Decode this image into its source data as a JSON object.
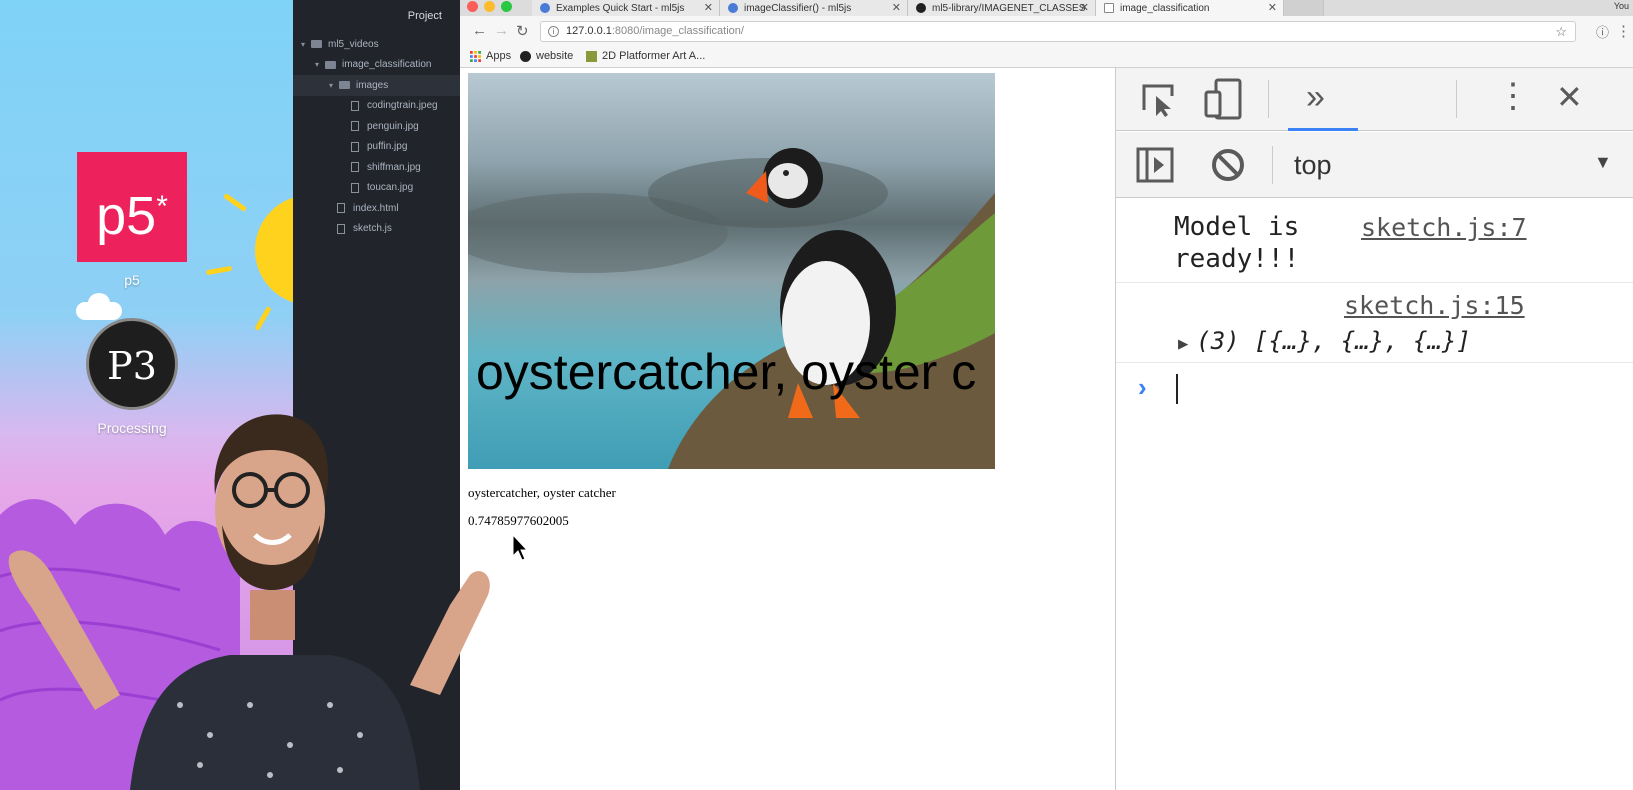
{
  "desktop": {
    "icons": [
      {
        "label": "p5",
        "tile_text": "p5",
        "tile_sup": "*"
      },
      {
        "label": "Processing"
      }
    ]
  },
  "editor": {
    "header": "Project",
    "tree": [
      {
        "label": "ml5_videos",
        "type": "folder",
        "expanded": true,
        "depth": 0
      },
      {
        "label": "image_classification",
        "type": "folder",
        "expanded": true,
        "depth": 1
      },
      {
        "label": "images",
        "type": "folder",
        "expanded": true,
        "depth": 2,
        "selected": true
      },
      {
        "label": "codingtrain.jpeg",
        "type": "file",
        "depth": 3
      },
      {
        "label": "penguin.jpg",
        "type": "file",
        "depth": 3
      },
      {
        "label": "puffin.jpg",
        "type": "file",
        "depth": 3
      },
      {
        "label": "shiffman.jpg",
        "type": "file",
        "depth": 3
      },
      {
        "label": "toucan.jpg",
        "type": "file",
        "depth": 3
      },
      {
        "label": "index.html",
        "type": "file",
        "depth": 2
      },
      {
        "label": "sketch.js",
        "type": "file",
        "depth": 2
      }
    ]
  },
  "browser": {
    "tabs": [
      {
        "title": "Examples Quick Start - ml5js",
        "icon": "ml5-icon"
      },
      {
        "title": "imageClassifier() - ml5js",
        "icon": "ml5-icon"
      },
      {
        "title": "ml5-library/IMAGENET_CLASSES",
        "icon": "github-icon"
      },
      {
        "title": "image_classification",
        "icon": "document-icon",
        "active": true
      }
    ],
    "url_host": "127.0.0.1",
    "url_path": ":8080/image_classification/",
    "bookmarks": [
      {
        "label": "Apps",
        "icon": "apps-grid-icon"
      },
      {
        "label": "website",
        "icon": "github-icon"
      },
      {
        "label": "2D Platformer Art A...",
        "icon": "bookmark-icon"
      }
    ],
    "profile_label": "You"
  },
  "page": {
    "canvas_label": "oystercatcher, oyster c",
    "result_label": "oystercatcher, oyster catcher",
    "confidence": "0.74785977602005"
  },
  "devtools": {
    "context": "top",
    "messages": [
      {
        "text_line1": "Model is",
        "text_line2": "ready!!!",
        "source": "sketch.js:7"
      },
      {
        "text": "(3) [{…}, {…}, {…}]",
        "source": "sketch.js:15"
      }
    ],
    "accent": "#3c82f7"
  },
  "colors": {
    "p5_brand": "#ed225d",
    "editor_bg": "#21252b",
    "sun": "#ffd21e"
  }
}
